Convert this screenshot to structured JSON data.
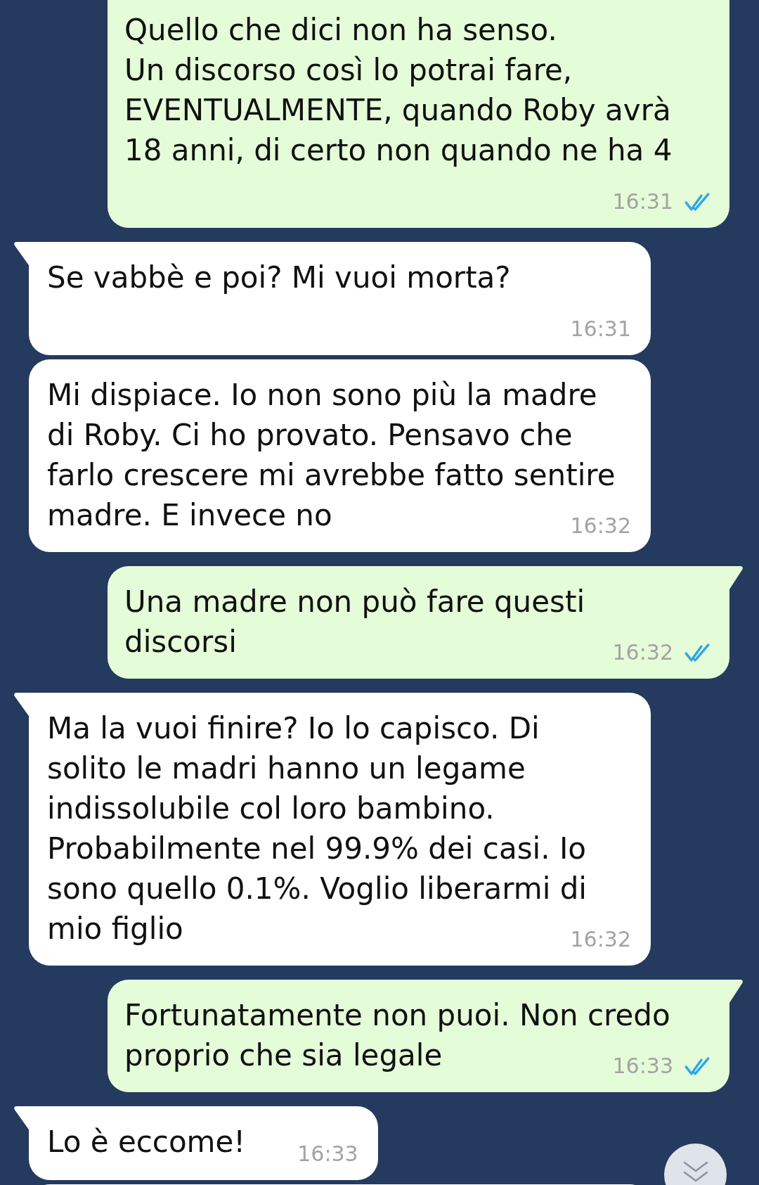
{
  "messages": [
    {
      "kind": "outgoing",
      "lines": [
        "Quello che dici non ha senso.",
        "Un discorso così lo potrai fare,",
        "EVENTUALMENTE, quando Roby avrà",
        "18 anni, di certo non quando ne ha 4"
      ],
      "time": "16:31",
      "time_below": true,
      "read": true
    },
    {
      "kind": "incoming",
      "lines": [
        "Se vabbè e poi? Mi vuoi morta?"
      ],
      "time": "16:31",
      "time_below": true
    },
    {
      "kind": "incoming",
      "lines": [
        "Mi dispiace. Io non sono più la madre",
        "di Roby. Ci ho provato. Pensavo che",
        "farlo crescere mi avrebbe fatto sentire",
        "madre. E invece no"
      ],
      "time": "16:32",
      "time_below": false
    },
    {
      "kind": "outgoing",
      "lines": [
        "Una madre non può fare questi",
        "discorsi"
      ],
      "time": "16:32",
      "time_below": false,
      "read": true
    },
    {
      "kind": "incoming",
      "lines": [
        "Ma la vuoi finire? Io lo capisco. Di",
        "solito le madri hanno un legame",
        "indissolubile col loro bambino.",
        "Probabilmente nel 99.9% dei casi. Io",
        "sono quello 0.1%. Voglio liberarmi di",
        "mio figlio"
      ],
      "time": "16:32",
      "time_below": false
    },
    {
      "kind": "outgoing",
      "lines": [
        "Fortunatamente non puoi. Non credo",
        "proprio che sia legale"
      ],
      "time": "16:33",
      "time_below": false,
      "read": true
    },
    {
      "kind": "incoming",
      "lines": [
        "Lo è eccome!"
      ],
      "time": "16:33",
      "time_below": false
    },
    {
      "kind": "incoming"
    }
  ],
  "scroll_down_button": {
    "visible": true
  }
}
